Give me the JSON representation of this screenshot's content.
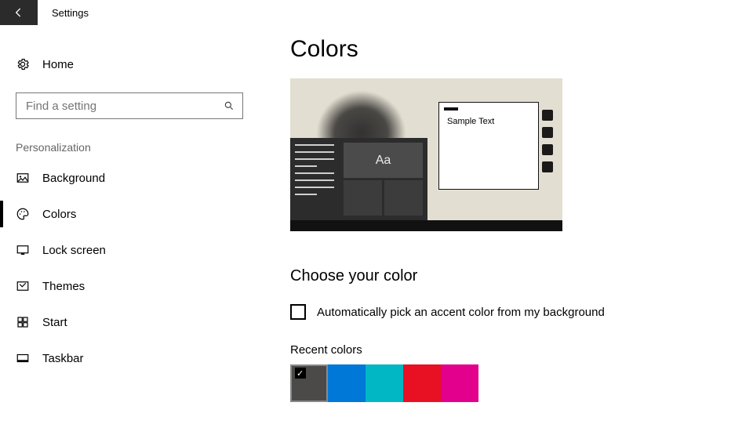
{
  "app": {
    "title": "Settings"
  },
  "sidebar": {
    "home_label": "Home",
    "search_placeholder": "Find a setting",
    "section_label": "Personalization",
    "items": [
      {
        "label": "Background"
      },
      {
        "label": "Colors"
      },
      {
        "label": "Lock screen"
      },
      {
        "label": "Themes"
      },
      {
        "label": "Start"
      },
      {
        "label": "Taskbar"
      }
    ],
    "active_index": 1
  },
  "main": {
    "title": "Colors",
    "preview": {
      "sample_text": "Sample Text",
      "tile_text": "Aa"
    },
    "choose_heading": "Choose your color",
    "auto_pick_label": "Automatically pick an accent color from my background",
    "auto_pick_checked": false,
    "recent_label": "Recent colors",
    "recent_colors": [
      {
        "hex": "#4c4a48",
        "selected": true
      },
      {
        "hex": "#0078d7",
        "selected": false
      },
      {
        "hex": "#00b7c3",
        "selected": false
      },
      {
        "hex": "#e81123",
        "selected": false
      },
      {
        "hex": "#e3008c",
        "selected": false
      }
    ]
  }
}
